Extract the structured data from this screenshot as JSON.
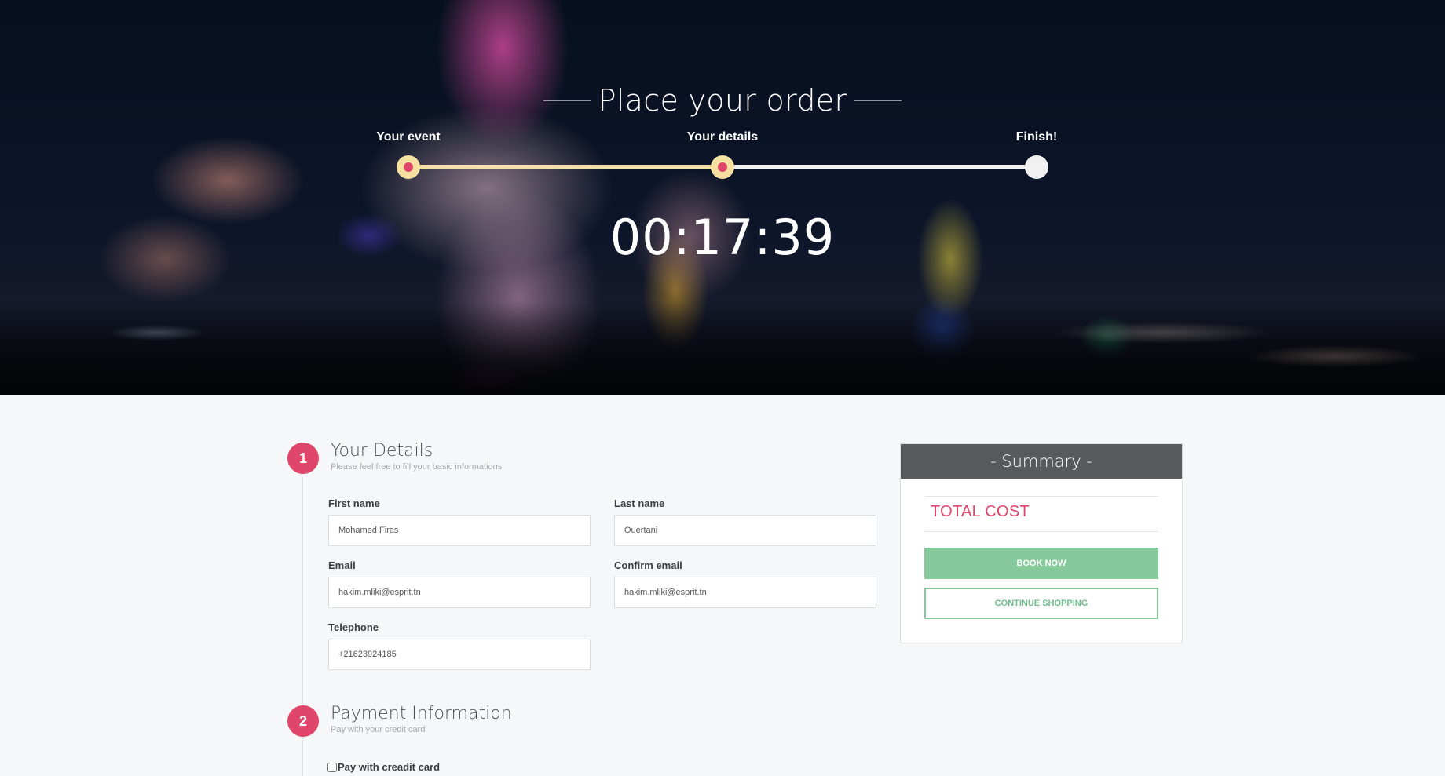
{
  "header": {
    "title": "Place your order",
    "timer": "00:17:39",
    "steps": [
      {
        "label": "Your event",
        "state": "done"
      },
      {
        "label": "Your details",
        "state": "current"
      },
      {
        "label": "Finish!",
        "state": "pending"
      }
    ],
    "progress_fraction": 0.5
  },
  "sections": [
    {
      "number": "1",
      "title": "Your Details",
      "subtitle": "Please feel free to fill your basic informations"
    },
    {
      "number": "2",
      "title": "Payment Information",
      "subtitle": "Pay with your credit card"
    }
  ],
  "details_form": {
    "first_name": {
      "label": "First name",
      "value": "Mohamed Firas"
    },
    "last_name": {
      "label": "Last name",
      "value": "Ouertani"
    },
    "email": {
      "label": "Email",
      "value": "hakim.mliki@esprit.tn"
    },
    "confirm_email": {
      "label": "Confirm email",
      "value": "hakim.mliki@esprit.tn"
    },
    "telephone": {
      "label": "Telephone",
      "value": "+21623924185"
    }
  },
  "payment": {
    "checkbox_label": "Pay with creadit card",
    "checked": false
  },
  "summary": {
    "title": "- Summary -",
    "total_label": "TOTAL COST",
    "book_button": "BOOK NOW",
    "continue_button": "CONTINUE SHOPPING"
  },
  "colors": {
    "accent": "#e0456a",
    "progress_fill": "#f6e1a3",
    "book_green": "#86c99c",
    "summary_header": "#57595b"
  }
}
